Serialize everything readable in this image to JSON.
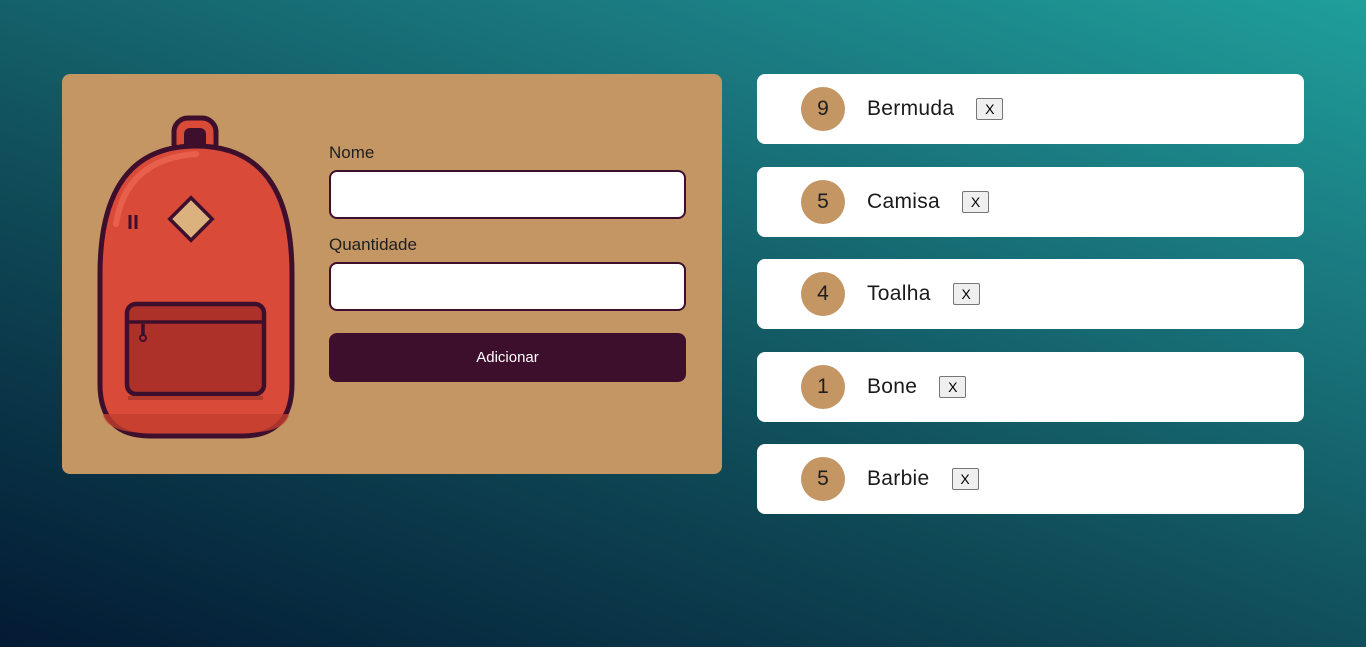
{
  "form": {
    "name_label": "Nome",
    "name_value": "",
    "quantity_label": "Quantidade",
    "quantity_value": "",
    "add_button_label": "Adicionar",
    "illustration": "backpack-icon"
  },
  "items": [
    {
      "quantity": "9",
      "name": "Bermuda",
      "remove_label": "X"
    },
    {
      "quantity": "5",
      "name": "Camisa",
      "remove_label": "X"
    },
    {
      "quantity": "4",
      "name": "Toalha",
      "remove_label": "X"
    },
    {
      "quantity": "1",
      "name": "Bone",
      "remove_label": "X"
    },
    {
      "quantity": "5",
      "name": "Barbie",
      "remove_label": "X"
    }
  ],
  "colors": {
    "card_background": "#c49663",
    "button_background": "#3e0f2c",
    "backpack_body": "#d94a38",
    "background_start": "#031a33",
    "background_end": "#1f9f9b"
  }
}
